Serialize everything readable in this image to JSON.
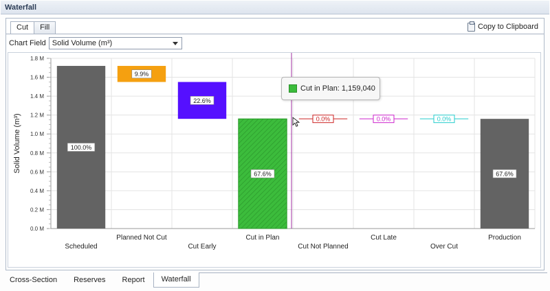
{
  "panel": {
    "title": "Waterfall"
  },
  "tabs": [
    {
      "label": "Cut",
      "active": true
    },
    {
      "label": "Fill",
      "active": false
    }
  ],
  "toolbar": {
    "copy_label": "Copy to Clipboard",
    "copy_icon": "clipboard-icon"
  },
  "chart_field": {
    "label": "Chart Field",
    "value": "Solid Volume (m³)"
  },
  "tooltip": {
    "text": "Cut in Plan: 1,159,040",
    "swatch_color": "#3cbc3c"
  },
  "bottom_tabs": [
    {
      "label": "Cross-Section",
      "active": false
    },
    {
      "label": "Reserves",
      "active": false
    },
    {
      "label": "Report",
      "active": false
    },
    {
      "label": "Waterfall",
      "active": true
    }
  ],
  "chart_data": {
    "type": "bar",
    "subtype": "waterfall",
    "ylabel": "Solid Volume (m³)",
    "ylim": [
      0,
      1.8
    ],
    "y_unit_suffix": " M",
    "yticks": [
      "0.0 M",
      "0.2 M",
      "0.4 M",
      "0.6 M",
      "0.8 M",
      "1.0 M",
      "1.2 M",
      "1.4 M",
      "1.6 M",
      "1.8 M"
    ],
    "grid": true,
    "categories": [
      "Scheduled",
      "Planned Not Cut",
      "Cut Early",
      "Cut in Plan",
      "Cut Not Planned",
      "Cut Late",
      "Over Cut",
      "Production"
    ],
    "bars": [
      {
        "category": "Scheduled",
        "start": 0,
        "end": 1.72,
        "label": "100.0%",
        "color": "#636363",
        "style": "solid"
      },
      {
        "category": "Planned Not Cut",
        "start": 1.55,
        "end": 1.72,
        "label": "9.9%",
        "color": "#f5a010",
        "style": "solid"
      },
      {
        "category": "Cut Early",
        "start": 1.16,
        "end": 1.55,
        "label": "22.6%",
        "color": "#5510ff",
        "style": "solid"
      },
      {
        "category": "Cut in Plan",
        "start": 0,
        "end": 1.16,
        "label": "67.6%",
        "color": "#3cbc3c",
        "style": "hatched"
      },
      {
        "category": "Cut Not Planned",
        "start": 1.16,
        "end": 1.16,
        "label": "0.0%",
        "color": "#cc2222",
        "style": "line"
      },
      {
        "category": "Cut Late",
        "start": 1.16,
        "end": 1.16,
        "label": "0.0%",
        "color": "#cc22cc",
        "style": "line"
      },
      {
        "category": "Over Cut",
        "start": 1.16,
        "end": 1.16,
        "label": "0.0%",
        "color": "#22cccc",
        "style": "line"
      },
      {
        "category": "Production",
        "start": 0,
        "end": 1.16,
        "label": "67.6%",
        "color": "#636363",
        "style": "solid"
      }
    ],
    "cursor_category": "Cut in Plan",
    "cursor_color": "#a030a0"
  }
}
